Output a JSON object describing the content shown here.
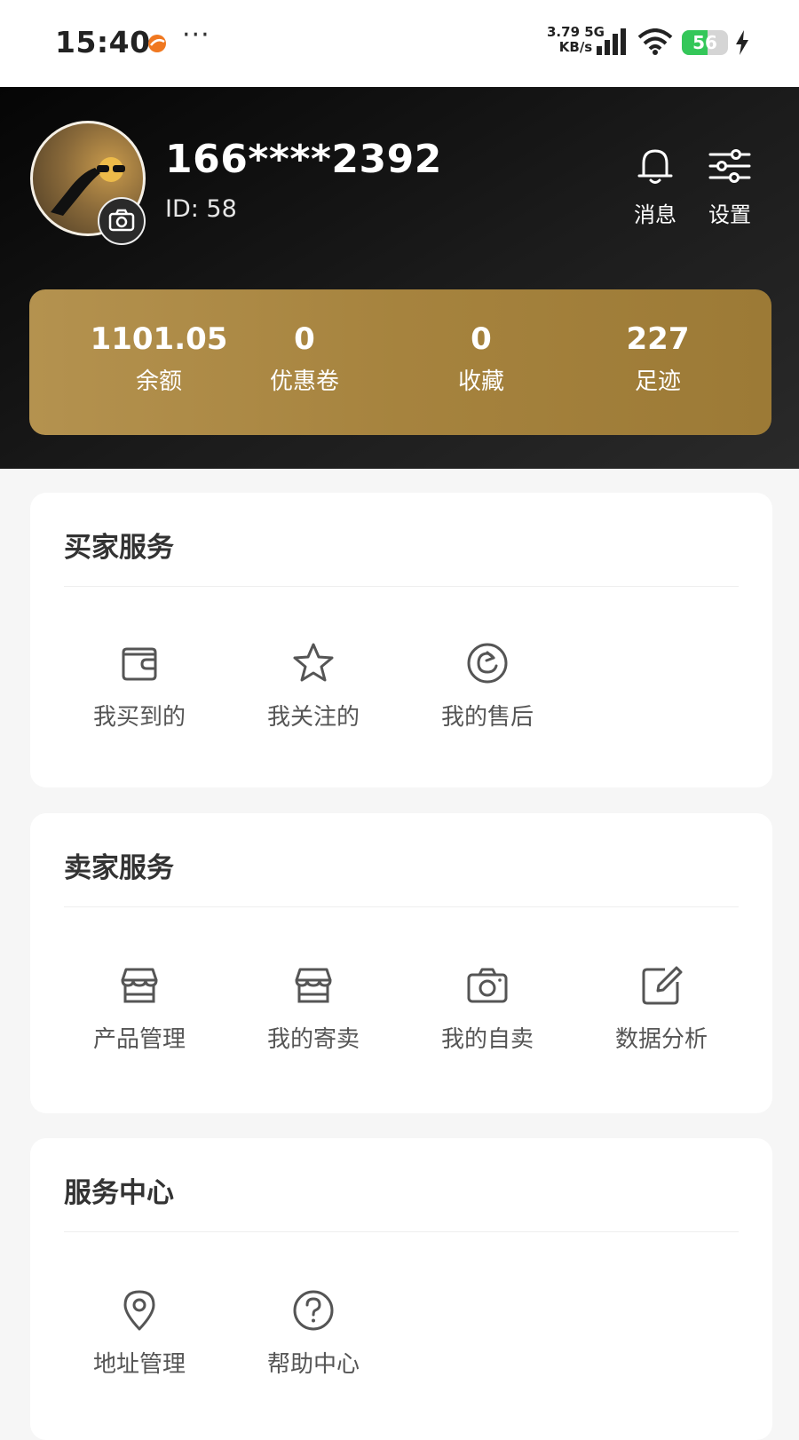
{
  "status_bar": {
    "time": "15:40",
    "dots": "···",
    "speed_value": "3.79",
    "speed_unit": "KB/s",
    "network": "5G",
    "battery": "56",
    "battery_level": 0.56
  },
  "profile": {
    "username": "166****2392",
    "id_text": "ID: 58",
    "messages_label": "消息",
    "settings_label": "设置"
  },
  "stats": [
    {
      "value": "1101.05",
      "label": "余额"
    },
    {
      "value": "0",
      "label": "优惠卷"
    },
    {
      "value": "0",
      "label": "收藏"
    },
    {
      "value": "227",
      "label": "足迹"
    }
  ],
  "buyer_services": {
    "title": "买家服务",
    "items": [
      {
        "label": "我买到的",
        "icon": "wallet-icon"
      },
      {
        "label": "我关注的",
        "icon": "star-icon"
      },
      {
        "label": "我的售后",
        "icon": "refresh-icon"
      }
    ]
  },
  "seller_services": {
    "title": "卖家服务",
    "items": [
      {
        "label": "产品管理",
        "icon": "store-icon"
      },
      {
        "label": "我的寄卖",
        "icon": "store-icon"
      },
      {
        "label": "我的自卖",
        "icon": "camera-icon"
      },
      {
        "label": "数据分析",
        "icon": "edit-icon"
      }
    ]
  },
  "service_center": {
    "title": "服务中心",
    "items": [
      {
        "label": "地址管理",
        "icon": "location-pin-icon"
      },
      {
        "label": "帮助中心",
        "icon": "help-icon"
      }
    ]
  }
}
